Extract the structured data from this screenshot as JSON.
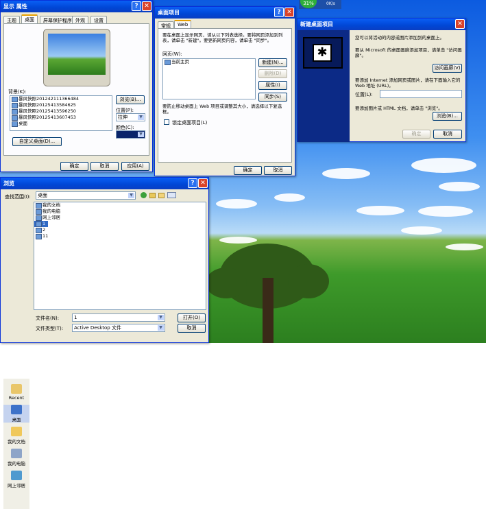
{
  "display_props": {
    "title": "显示 属性",
    "tabs": [
      "主题",
      "桌面",
      "屏幕保护程序",
      "外观",
      "设置"
    ],
    "background_label": "背景(K):",
    "backgrounds": [
      "暴风快照201242111366484",
      "暴风快照20125413584625",
      "暴风快照20125413596250",
      "暴风快照20125413607453",
      "桌面"
    ],
    "browse": "浏览(B)...",
    "position_label": "位置(P):",
    "position_value": "拉伸",
    "color_label": "颜色(C):",
    "customize": "自定义桌面(D)...",
    "ok": "确定",
    "cancel": "取消",
    "apply": "应用(A)"
  },
  "desktop_items": {
    "title": "桌面项目",
    "tabs": [
      "常规",
      "Web"
    ],
    "desc": "要在桌面上显示网页，请从以下列表选择。要将网页添加到列表，请单击 \"新建\"。要更新网页内容，请单击 \"同步\"。",
    "webpages_label": "网页(W):",
    "webpages": [
      "当前主页"
    ],
    "new": "新建(N)...",
    "delete": "删除(D)",
    "props": "属性(I)",
    "sync": "同步(S)",
    "lock_desc": "要防止移动桌面上 Web 项目或调整其大小，请选择以下复选框。",
    "lock_label": "锁定桌面项目(L)",
    "ok": "确定",
    "cancel": "取消"
  },
  "new_item": {
    "title": "新建桌面项目",
    "line1": "您可以将活动的内容或图片添加到的桌面上。",
    "line2": "要从 Microsoft 的桌面画廊添加项目，请单击 \"访问画廊\"。",
    "gallery": "访问画廊(V)",
    "line3": "要添加 Internet 添加网页或图片，请在下面输入它的 Web 地址 (URL)。",
    "location_label": "位置(L):",
    "line4": "要添加图片或 HTML 文档，请单击 \"浏览\"。",
    "browse": "浏览(B)...",
    "ok": "确定",
    "cancel": "取消"
  },
  "browse": {
    "title": "浏览",
    "lookin_label": "查找范围(I):",
    "lookin_value": "桌面",
    "places": [
      "Recent",
      "桌面",
      "我的文档",
      "我的电脑",
      "网上邻居"
    ],
    "files": [
      "我的文档",
      "我的电脑",
      "网上邻居",
      "1",
      "2",
      "11"
    ],
    "filename_label": "文件名(N):",
    "filename_value": "1",
    "filetype_label": "文件类型(T):",
    "filetype_value": "Active Desktop 文件",
    "open": "打开(O)",
    "cancel": "取消"
  },
  "tray": {
    "cpu": "31%",
    "net": "0K/s"
  },
  "colors": {
    "accent": "#0a5ff5",
    "close": "#d9432a",
    "face": "#ece9d8"
  }
}
